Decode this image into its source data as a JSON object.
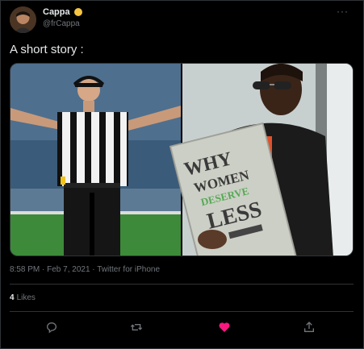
{
  "user": {
    "display_name": "Cappa",
    "handle": "@frCappa"
  },
  "tweet": {
    "text": "A short story :",
    "timestamp": "8:58 PM · Feb 7, 2021 · Twitter for iPhone"
  },
  "book": {
    "line1": "WHY",
    "line2": "WOMEN",
    "line3": "DESERVE",
    "line4": "LESS"
  },
  "stats": {
    "likes_count": "4",
    "likes_label": "Likes"
  },
  "icons": {
    "more": "more-dots-icon",
    "reply": "reply-icon",
    "retweet": "retweet-icon",
    "like": "heart-icon",
    "share": "share-icon"
  },
  "colors": {
    "background": "#000000",
    "text_primary": "#e7e9ea",
    "text_secondary": "#71767b",
    "border": "#2f3336",
    "like_active": "#f91880"
  }
}
